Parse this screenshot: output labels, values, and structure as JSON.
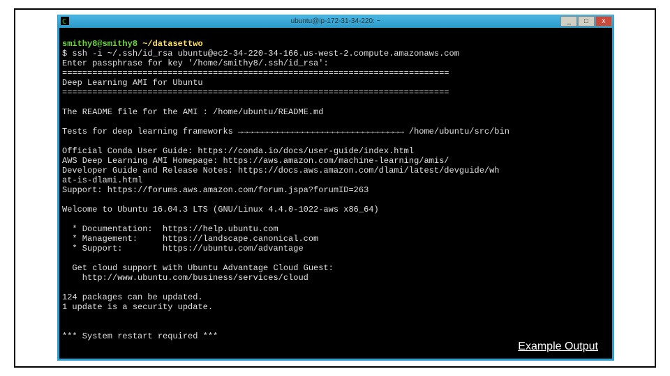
{
  "titlebar": {
    "title": "ubuntu@ip-172-31-34-220: ~",
    "min": "_",
    "max": "□",
    "close": "x"
  },
  "prompt": {
    "user": "smithy8@smithy8",
    "path": "~/datasettwo"
  },
  "lines": {
    "ssh": "$ ssh -i ~/.ssh/id_rsa ubuntu@ec2-34-220-34-166.us-west-2.compute.amazonaws.com",
    "pass": "Enter passphrase for key '/home/smithy8/.ssh/id_rsa':",
    "bar1": "=============================================================================",
    "ami": "Deep Learning AMI for Ubuntu",
    "bar2": "=============================================================================",
    "blank1": "",
    "readme": "The README file for the AMI : /home/ubuntu/README.md",
    "blank2": "",
    "tests": "Tests for deep learning frameworks →→→→→→→→→→→→→→→→→→→→→→→→→→→→→→→→→ /home/ubuntu/src/bin",
    "blank3": "",
    "conda": "Official Conda User Guide: https://conda.io/docs/user-guide/index.html",
    "aws": "AWS Deep Learning AMI Homepage: https://aws.amazon.com/machine-learning/amis/",
    "dev": "Developer Guide and Release Notes: https://docs.aws.amazon.com/dlami/latest/devguide/wh",
    "dev2": "at-is-dlami.html",
    "sup": "Support: https://forums.aws.amazon.com/forum.jspa?forumID=263",
    "blank4": "",
    "welcome": "Welcome to Ubuntu 16.04.3 LTS (GNU/Linux 4.4.0-1022-aws x86_64)",
    "blank5": "",
    "doc": "  * Documentation:  https://help.ubuntu.com",
    "mgmt": "  * Management:     https://landscape.canonical.com",
    "sup2": "  * Support:        https://ubuntu.com/advantage",
    "blank6": "",
    "cloud1": "  Get cloud support with Ubuntu Advantage Cloud Guest:",
    "cloud2": "    http://www.ubuntu.com/business/services/cloud",
    "blank7": "",
    "pkgs": "124 packages can be updated.",
    "sec": "1 update is a security update.",
    "blank8": "",
    "blank9": "",
    "restart": "*** System restart required ***"
  },
  "caption": "Example Output"
}
